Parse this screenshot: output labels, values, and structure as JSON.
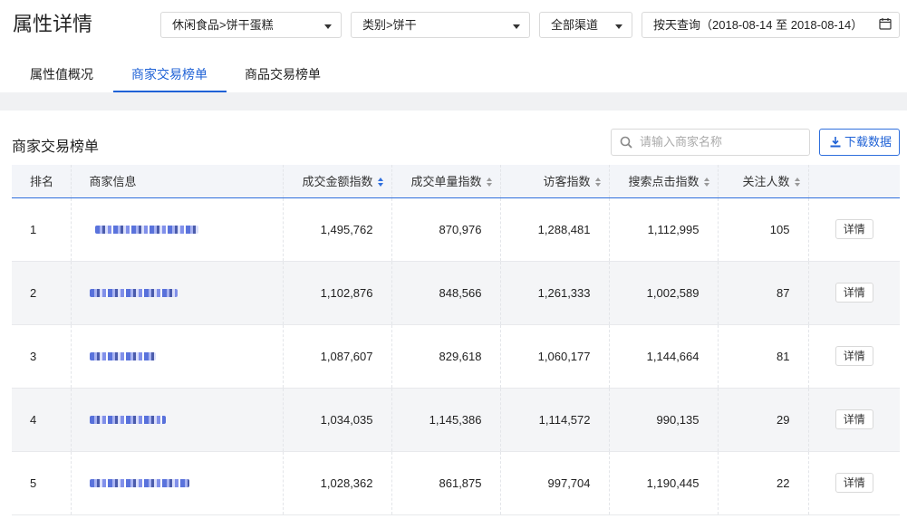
{
  "header": {
    "title": "属性详情",
    "category_select": "休闲食品>饼干蛋糕",
    "type_select": "类别>饼干",
    "channel_select": "全部渠道",
    "date_range": "按天查询（2018-08-14 至 2018-08-14）"
  },
  "tabs": [
    {
      "label": "属性值概况"
    },
    {
      "label": "商家交易榜单"
    },
    {
      "label": "商品交易榜单"
    }
  ],
  "active_tab": 1,
  "section": {
    "title": "商家交易榜单",
    "search_placeholder": "请输入商家名称",
    "download_label": "下载数据"
  },
  "table": {
    "columns": [
      "排名",
      "商家信息",
      "成交金额指数",
      "成交单量指数",
      "访客指数",
      "搜索点击指数",
      "关注人数",
      ""
    ],
    "rows": [
      {
        "rank": "1",
        "gmv": "1,495,762",
        "orders": "870,976",
        "visitors": "1,288,481",
        "search_clicks": "1,112,995",
        "followers": "105",
        "action": "详情"
      },
      {
        "rank": "2",
        "gmv": "1,102,876",
        "orders": "848,566",
        "visitors": "1,261,333",
        "search_clicks": "1,002,589",
        "followers": "87",
        "action": "详情"
      },
      {
        "rank": "3",
        "gmv": "1,087,607",
        "orders": "829,618",
        "visitors": "1,060,177",
        "search_clicks": "1,144,664",
        "followers": "81",
        "action": "详情"
      },
      {
        "rank": "4",
        "gmv": "1,034,035",
        "orders": "1,145,386",
        "visitors": "1,114,572",
        "search_clicks": "990,135",
        "followers": "29",
        "action": "详情"
      },
      {
        "rank": "5",
        "gmv": "1,028,362",
        "orders": "861,875",
        "visitors": "997,704",
        "search_clicks": "1,190,445",
        "followers": "22",
        "action": "详情"
      }
    ]
  },
  "colors": {
    "accent": "#1f62d6",
    "header_row_bg": "#f3f5f9",
    "alt_row_bg": "#f4f5f7"
  }
}
